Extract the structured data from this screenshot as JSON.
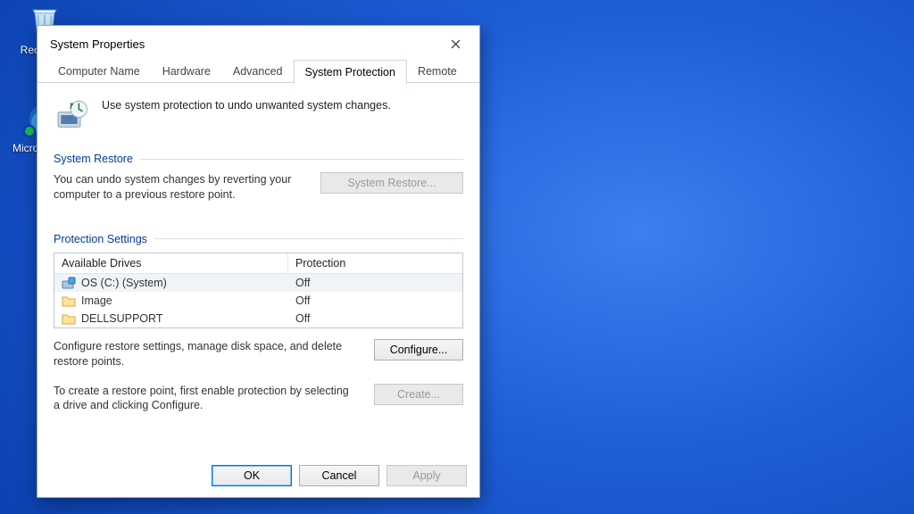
{
  "desktop": {
    "icons": [
      {
        "id": "recycle-bin",
        "label": "Recycle…"
      },
      {
        "id": "ms-edge",
        "label": "Microsoft E…"
      }
    ]
  },
  "window": {
    "title": "System Properties",
    "close_aria": "Close",
    "tabs": [
      {
        "id": "computer-name",
        "label": "Computer Name",
        "active": false
      },
      {
        "id": "hardware",
        "label": "Hardware",
        "active": false
      },
      {
        "id": "advanced",
        "label": "Advanced",
        "active": false
      },
      {
        "id": "system-protection",
        "label": "System Protection",
        "active": true
      },
      {
        "id": "remote",
        "label": "Remote",
        "active": false
      }
    ],
    "intro": "Use system protection to undo unwanted system changes.",
    "restore": {
      "heading": "System Restore",
      "text": "You can undo system changes by reverting your computer to a previous restore point.",
      "button": "System Restore...",
      "button_enabled": false
    },
    "protection": {
      "heading": "Protection Settings",
      "columns": {
        "drive": "Available Drives",
        "status": "Protection"
      },
      "drives": [
        {
          "name": "OS (C:) (System)",
          "status": "Off",
          "icon": "system-drive",
          "selected": true
        },
        {
          "name": "Image",
          "status": "Off",
          "icon": "folder",
          "selected": false
        },
        {
          "name": "DELLSUPPORT",
          "status": "Off",
          "icon": "folder",
          "selected": false
        }
      ],
      "configure": {
        "text": "Configure restore settings, manage disk space, and delete restore points.",
        "button": "Configure...",
        "button_enabled": true
      },
      "create": {
        "text": "To create a restore point, first enable protection by selecting a drive and clicking Configure.",
        "button": "Create...",
        "button_enabled": false
      }
    },
    "footer": {
      "ok": "OK",
      "cancel": "Cancel",
      "apply": "Apply",
      "apply_enabled": false
    }
  }
}
